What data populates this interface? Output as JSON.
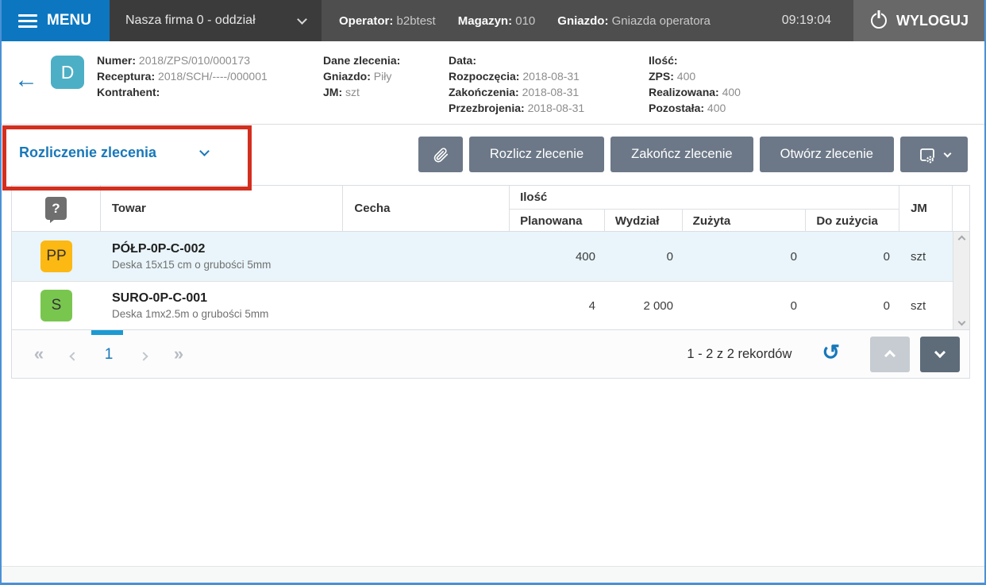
{
  "topbar": {
    "menu_label": "MENU",
    "company": "Nasza firma 0 - oddział",
    "operator_label": "Operator:",
    "operator_value": "b2btest",
    "magazyn_label": "Magazyn:",
    "magazyn_value": "010",
    "gniazdo_label": "Gniazdo:",
    "gniazdo_value": "Gniazda operatora",
    "time": "09:19:04",
    "logout_label": "WYLOGUJ"
  },
  "order_header": {
    "type_badge": "D",
    "numer_label": "Numer:",
    "numer": "2018/ZPS/010/000173",
    "receptura_label": "Receptura:",
    "receptura": "2018/SCH/----/000001",
    "kontrahent_label": "Kontrahent:",
    "kontrahent": "",
    "dane_title": "Dane zlecenia:",
    "gniazdo_label": "Gniazdo:",
    "gniazdo": "Piły",
    "jm_label": "JM:",
    "jm": "szt",
    "data_title": "Data:",
    "rozpoczecia_label": "Rozpoczęcia:",
    "rozpoczecia": "2018-08-31",
    "zakonczenia_label": "Zakończenia:",
    "zakonczenia": "2018-08-31",
    "przezbrojenia_label": "Przezbrojenia:",
    "przezbrojenia": "2018-08-31",
    "ilosc_title": "Ilość:",
    "zps_label": "ZPS:",
    "zps": "400",
    "realizowana_label": "Realizowana:",
    "realizowana": "400",
    "pozostala_label": "Pozostała:",
    "pozostala": "400"
  },
  "toolbar": {
    "view_selector": "Rozliczenie zlecenia",
    "buttons": [
      "Rozlicz zlecenie",
      "Zakończ zlecenie",
      "Otwórz zlecenie"
    ]
  },
  "table": {
    "headers": {
      "towar": "Towar",
      "cecha": "Cecha",
      "ilosc_group": "Ilość",
      "planowana": "Planowana",
      "wydzial": "Wydział",
      "zuzyta": "Zużyta",
      "do_zuzycia": "Do zużycia",
      "jm": "JM"
    },
    "rows": [
      {
        "badge": "PP",
        "badge_color": "#fcb813",
        "name": "PÓŁP-0P-C-002",
        "desc": "Deska 15x15 cm o grubości 5mm",
        "planowana": "400",
        "wydzial": "0",
        "zuzyta": "0",
        "do_zuzycia": "0",
        "jm": "szt",
        "selected": true
      },
      {
        "badge": "S",
        "badge_color": "#79c64f",
        "name": "SURO-0P-C-001",
        "desc": "Deska 1mx2.5m o grubości 5mm",
        "planowana": "4",
        "wydzial": "2 000",
        "zuzyta": "0",
        "do_zuzycia": "0",
        "jm": "szt",
        "selected": false
      }
    ]
  },
  "footer": {
    "first_icon": "«",
    "last_icon": "»",
    "page": "1",
    "records_info": "1 - 2 z 2 rekordów",
    "refresh_icon": "↺"
  },
  "icons": {
    "hamburger": "menu-hamburger",
    "power": "power-symbol",
    "paperclip": "attachment-clip",
    "settings": "screen-with-gear",
    "question": "help-question-mark"
  },
  "colors": {
    "menu_blue": "#0c77c0",
    "accent_blue": "#1878ba",
    "pagination_active": "#1b9ad2",
    "button_slate": "#6c7887",
    "type_badge_teal": "#4cafc5",
    "badge_pp_yellow": "#fcb813",
    "badge_s_green": "#79c64f",
    "selected_row": "#e9f5fb",
    "annotation_red": "#d32f1f",
    "window_border_blue": "#4a90d8"
  }
}
